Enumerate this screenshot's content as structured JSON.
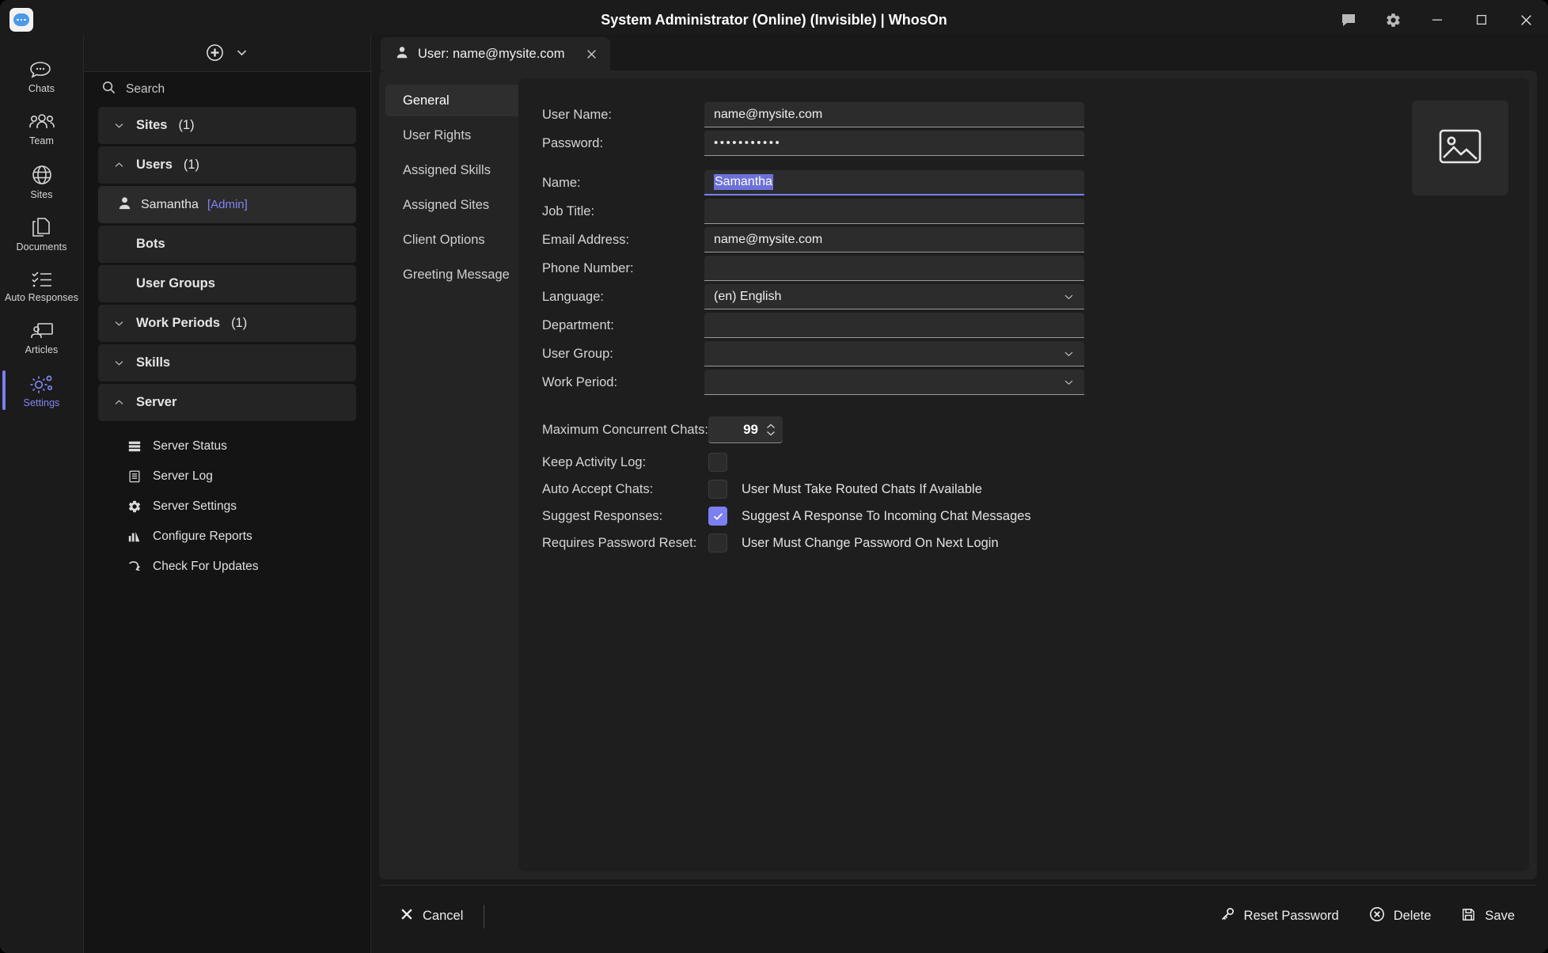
{
  "titlebar": {
    "app_title": "System Administrator (Online) (Invisible) | WhosOn",
    "chat_icon": "chat-icon",
    "settings_icon": "gear-icon",
    "minimize_icon": "minimize-icon",
    "maximize_icon": "maximize-icon",
    "close_icon": "close-icon"
  },
  "rail": {
    "items": [
      {
        "label": "Chats",
        "icon": "chats-icon",
        "active": false
      },
      {
        "label": "Team",
        "icon": "team-icon",
        "active": false
      },
      {
        "label": "Sites",
        "icon": "globe-icon",
        "active": false
      },
      {
        "label": "Documents",
        "icon": "documents-icon",
        "active": false
      },
      {
        "label": "Auto Responses",
        "icon": "checklist-icon",
        "active": false
      },
      {
        "label": "Articles",
        "icon": "articles-icon",
        "active": false
      },
      {
        "label": "Settings",
        "icon": "gears-icon",
        "active": true
      }
    ]
  },
  "tree": {
    "add_icon": "add-circle-icon",
    "dropdown_icon": "chevron-down-icon",
    "search_placeholder": "Search",
    "search_value": "",
    "nodes": [
      {
        "label": "Sites",
        "count": "(1)",
        "expanded": false
      },
      {
        "label": "Users",
        "count": "(1)",
        "expanded": true
      },
      {
        "label": "Bots",
        "count": "",
        "expanded": null
      },
      {
        "label": "User Groups",
        "count": "",
        "expanded": null
      },
      {
        "label": "Work Periods",
        "count": "(1)",
        "expanded": false
      },
      {
        "label": "Skills",
        "count": "",
        "expanded": false
      },
      {
        "label": "Server",
        "count": "",
        "expanded": true
      }
    ],
    "user": {
      "name": "Samantha",
      "tag": "[Admin]",
      "icon": "user-icon"
    },
    "server_items": [
      {
        "label": "Server Status",
        "icon": "server-icon"
      },
      {
        "label": "Server Log",
        "icon": "log-icon"
      },
      {
        "label": "Server Settings",
        "icon": "gear-icon"
      },
      {
        "label": "Configure Reports",
        "icon": "bar-chart-icon"
      },
      {
        "label": "Check For Updates",
        "icon": "refresh-icon"
      }
    ]
  },
  "document_tab": {
    "label": "User: name@mysite.com",
    "icon": "user-icon",
    "close_icon": "close-icon"
  },
  "subtabs": [
    {
      "label": "General",
      "active": true
    },
    {
      "label": "User Rights",
      "active": false
    },
    {
      "label": "Assigned Skills",
      "active": false
    },
    {
      "label": "Assigned Sites",
      "active": false
    },
    {
      "label": "Client Options",
      "active": false
    },
    {
      "label": "Greeting Message",
      "active": false
    }
  ],
  "form": {
    "fields": [
      {
        "label": "User Name:",
        "value": "name@mysite.com",
        "type": "text",
        "focused": false,
        "selected": false
      },
      {
        "label": "Password:",
        "value": "•••••••••••",
        "type": "password",
        "focused": false,
        "selected": false
      },
      {
        "label": "Name:",
        "value": "Samantha",
        "type": "text",
        "focused": true,
        "selected": true
      },
      {
        "label": "Job Title:",
        "value": "",
        "type": "text",
        "focused": false,
        "selected": false
      },
      {
        "label": "Email Address:",
        "value": "name@mysite.com",
        "type": "text",
        "focused": false,
        "selected": false
      },
      {
        "label": "Phone Number:",
        "value": "",
        "type": "text",
        "focused": false,
        "selected": false
      },
      {
        "label": "Language:",
        "value": "(en) English",
        "type": "select",
        "focused": false,
        "selected": false
      },
      {
        "label": "Department:",
        "value": "",
        "type": "text",
        "focused": false,
        "selected": false
      },
      {
        "label": "User Group:",
        "value": "",
        "type": "select",
        "focused": false,
        "selected": false
      },
      {
        "label": "Work Period:",
        "value": "",
        "type": "select",
        "focused": false,
        "selected": false
      }
    ],
    "max_chats": {
      "label": "Maximum Concurrent Chats:",
      "value": "99"
    },
    "checkboxes": [
      {
        "label": "Keep Activity Log:",
        "checked": false,
        "caption": ""
      },
      {
        "label": "Auto Accept Chats:",
        "checked": false,
        "caption": "User Must Take Routed Chats If Available"
      },
      {
        "label": "Suggest Responses:",
        "checked": true,
        "caption": "Suggest A Response To Incoming Chat Messages"
      },
      {
        "label": "Requires Password Reset:",
        "checked": false,
        "caption": "User Must Change Password On Next Login"
      }
    ],
    "avatar_icon": "image-placeholder-icon"
  },
  "bottombar": {
    "cancel": {
      "label": "Cancel",
      "icon": "close-icon"
    },
    "reset_password": {
      "label": "Reset Password",
      "icon": "key-icon"
    },
    "delete": {
      "label": "Delete",
      "icon": "delete-circle-icon"
    },
    "save": {
      "label": "Save",
      "icon": "save-disk-icon"
    }
  },
  "colors": {
    "accent": "#7b7ff0",
    "window_bg": "#1b1b1b",
    "panel_bg": "#242424",
    "card_bg": "#1e1e1e"
  }
}
